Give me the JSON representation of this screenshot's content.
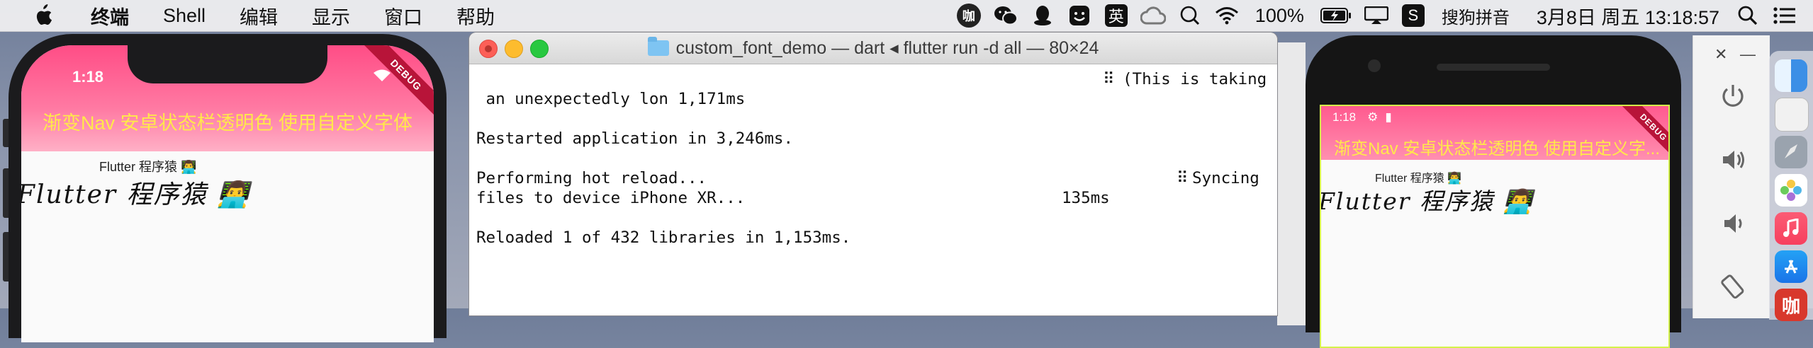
{
  "menubar": {
    "items": [
      "终端",
      "Shell",
      "编辑",
      "显示",
      "窗口",
      "帮助"
    ],
    "status": {
      "badge_char": "咖",
      "input_method_char": "英",
      "battery": "100%",
      "sogou_logo_char": "S",
      "sogou_label": "搜狗拼音",
      "datetime": "3月8日 周五  13:18:57"
    }
  },
  "terminal": {
    "title": "custom_font_demo — dart ◂ flutter run -d all — 80×24",
    "lines": [
      " an unexpectedly lon 1,171ms",
      "Restarted application in 3,246ms.",
      "Performing hot reload...",
      "files to device iPhone XR...",
      "Reloaded 1 of 432 libraries in 1,153ms."
    ],
    "taking_fragment": "(This is taking",
    "syncing_fragment": "Syncing",
    "syncing_time": "135ms"
  },
  "iphone": {
    "time": "1:18",
    "title": "渐变Nav 安卓状态栏透明色 使用自定义字体",
    "debug": "DEBUG",
    "small_label": "Flutter 程序猿 👨‍💻",
    "custom_label": "Flutter 程序猿 👨‍💻"
  },
  "android": {
    "time": "1:18",
    "title": "渐变Nav 安卓状态栏透明色 使用自定义字...",
    "debug": "DEBUG",
    "small_label": "Flutter 程序猿 👨‍💻",
    "custom_label": "Flutter 程序猿 👨‍💻"
  },
  "emulator_panel": {
    "close_glyph": "✕",
    "minimize_glyph": "—"
  },
  "dock": {
    "bottom_app_char": "咖"
  },
  "colors": {
    "appbar_pink": "#ff4d86",
    "title_yellow": "#ffe94a",
    "debug_ribbon": "#b81439",
    "emulator_border": "#d4f24a"
  }
}
